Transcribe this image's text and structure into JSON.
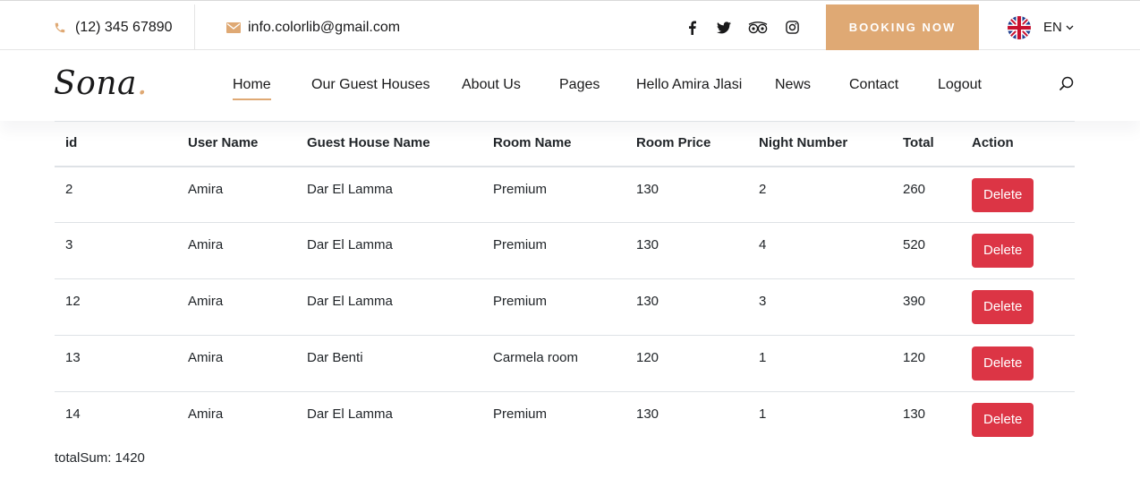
{
  "topbar": {
    "phone": "(12) 345 67890",
    "email": "info.colorlib@gmail.com",
    "social_icons": [
      "facebook-icon",
      "twitter-icon",
      "tripadvisor-icon",
      "instagram-icon"
    ],
    "booking_label": "BOOKING NOW",
    "language": "EN"
  },
  "brand": {
    "name": "Sona",
    "dot": ".",
    "accent_color": "#dfa974"
  },
  "nav": {
    "items": [
      {
        "label": "Home",
        "active": true
      },
      {
        "label": "Our Guest Houses"
      },
      {
        "label": "About Us"
      },
      {
        "label": "Pages"
      },
      {
        "label": "Hello Amira Jlasi"
      },
      {
        "label": "News"
      },
      {
        "label": "Contact"
      },
      {
        "label": "Logout"
      }
    ]
  },
  "table": {
    "headers": [
      "id",
      "User Name",
      "Guest House Name",
      "Room Name",
      "Room Price",
      "Night Number",
      "Total",
      "Action"
    ],
    "rows": [
      [
        "2",
        "Amira",
        "Dar El Lamma",
        "Premium",
        "130",
        "2",
        "260",
        "Delete"
      ],
      [
        "3",
        "Amira",
        "Dar El Lamma",
        "Premium",
        "130",
        "4",
        "520",
        "Delete"
      ],
      [
        "12",
        "Amira",
        "Dar El Lamma",
        "Premium",
        "130",
        "3",
        "390",
        "Delete"
      ],
      [
        "13",
        "Amira",
        "Dar Benti",
        "Carmela room",
        "120",
        "1",
        "120",
        "Delete"
      ],
      [
        "14",
        "Amira",
        "Dar El Lamma",
        "Premium",
        "130",
        "1",
        "130",
        "Delete"
      ]
    ],
    "delete_color": "#dc3545"
  },
  "summary": {
    "total_sum": "totalSum: 1420"
  }
}
